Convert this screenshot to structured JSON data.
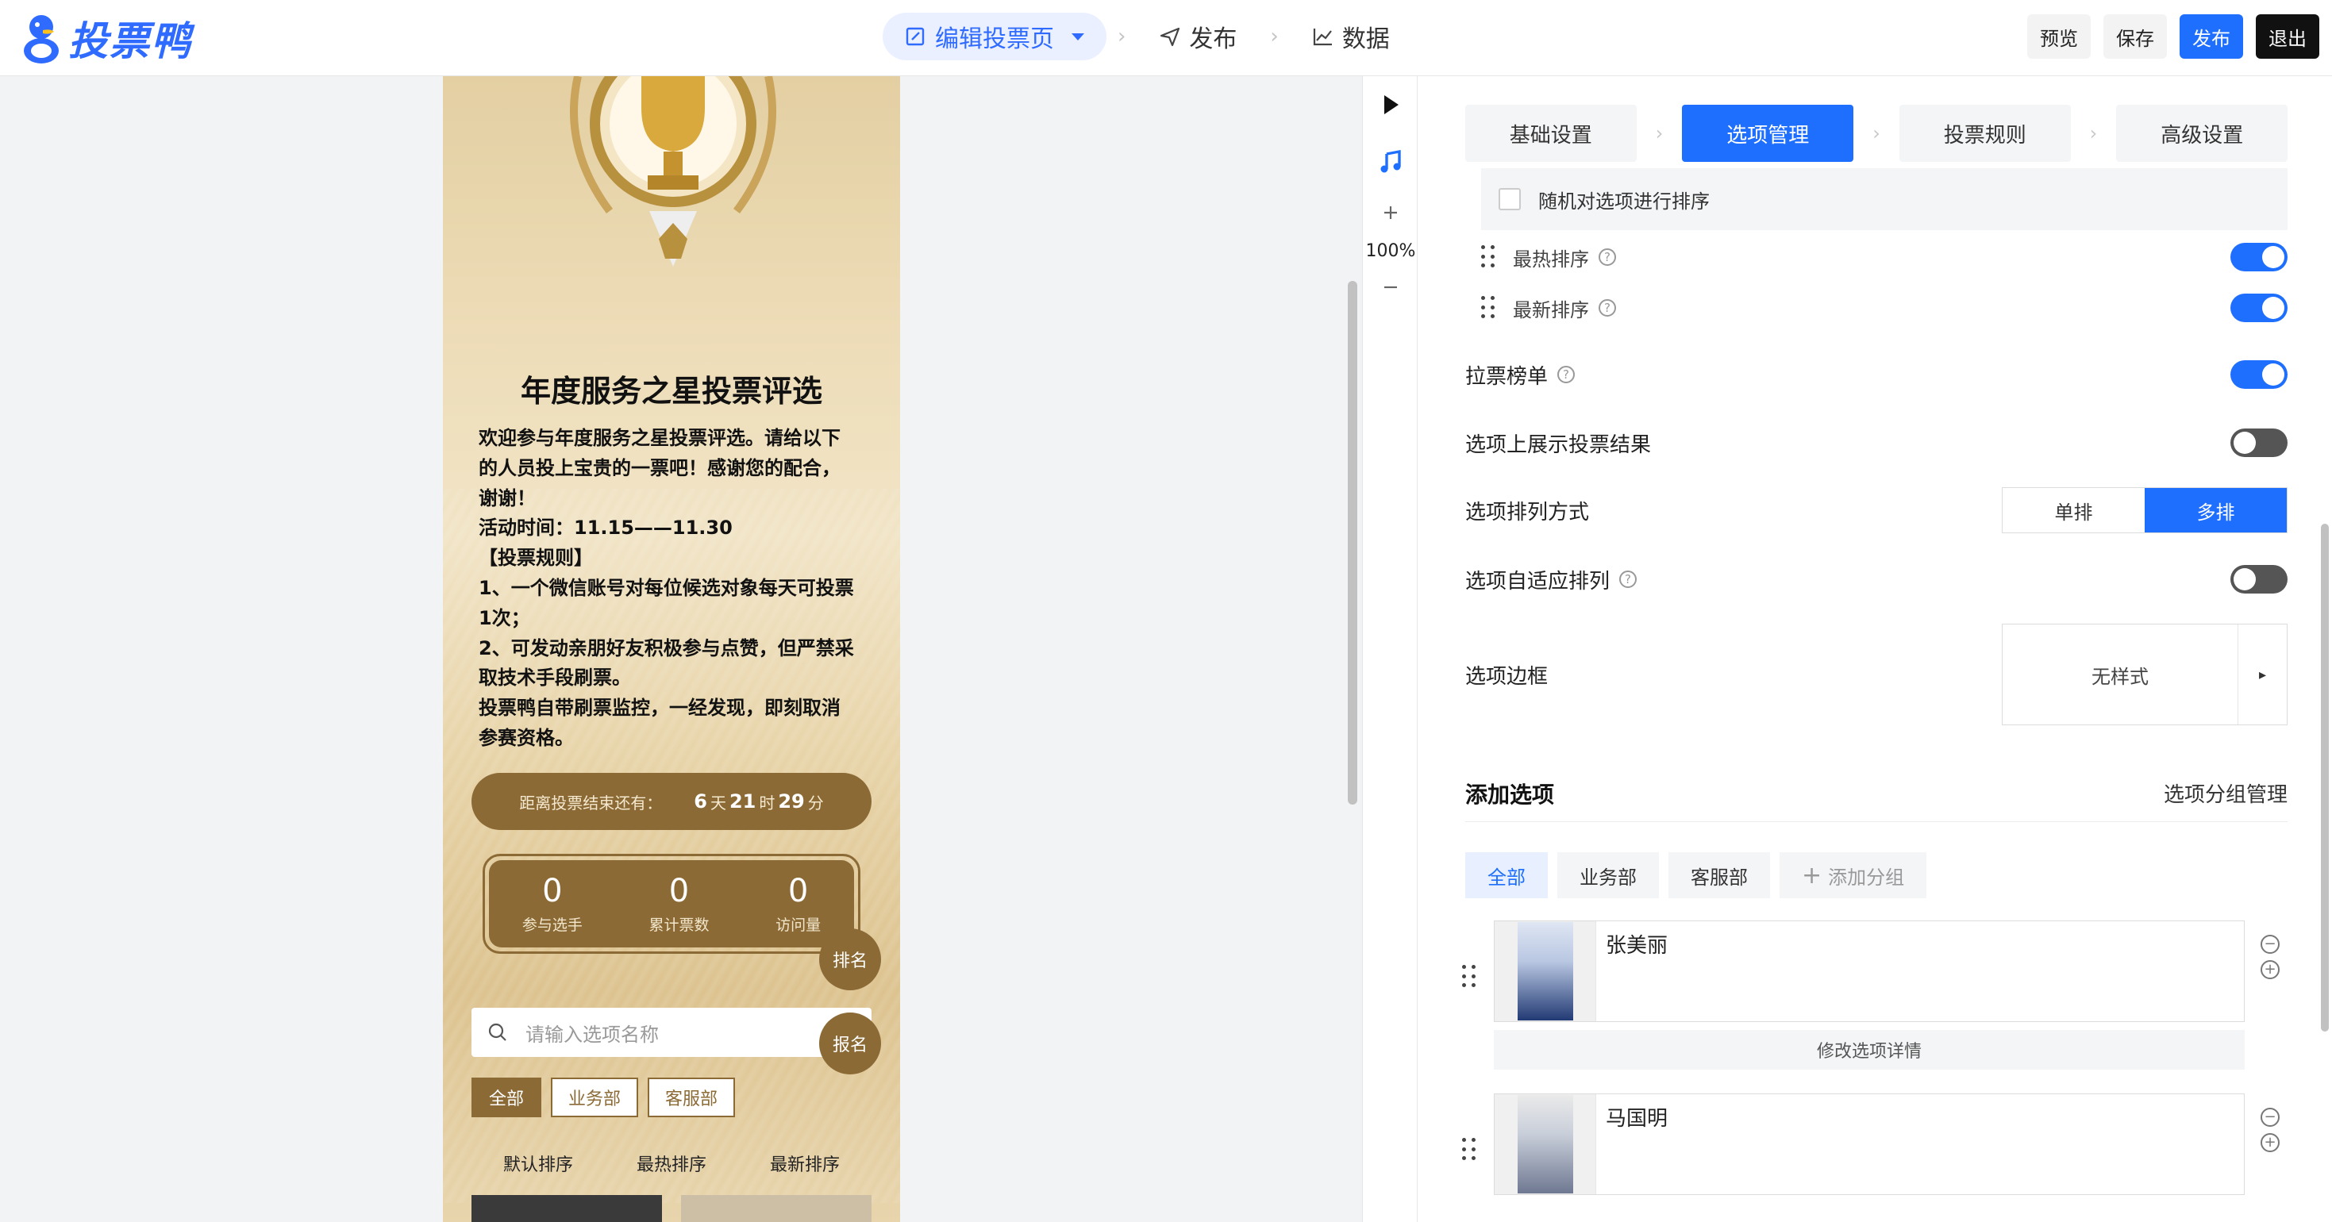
{
  "brand": {
    "name": "投票鸭"
  },
  "steps": [
    {
      "label": "编辑投票页",
      "icon": "edit-icon"
    },
    {
      "label": "发布",
      "icon": "send-icon"
    },
    {
      "label": "数据",
      "icon": "chart-icon"
    }
  ],
  "toolbar": {
    "preview": "预览",
    "save": "保存",
    "publish": "发布",
    "exit": "退出"
  },
  "canvas": {
    "zoom": "100%"
  },
  "phone": {
    "title": "年度服务之星投票评选",
    "description": [
      "欢迎参与年度服务之星投票评选。请给以下",
      "的人员投上宝贵的一票吧！感谢您的配合，",
      "谢谢！",
      "活动时间：11.15——11.30",
      "【投票规则】",
      "1、一个微信账号对每位候选对象每天可投票",
      "1次；",
      "2、可发动亲朋好友积极参与点赞，但严禁采",
      "取技术手段刷票。",
      "投票鸭自带刷票监控，一经发现，即刻取消",
      "参赛资格。"
    ],
    "countdown": {
      "label": "距离投票结束还有：",
      "days": "6",
      "days_unit": "天",
      "hours": "21",
      "hours_unit": "时",
      "minutes": "29",
      "minutes_unit": "分"
    },
    "stats": [
      {
        "value": "0",
        "label": "参与选手"
      },
      {
        "value": "0",
        "label": "累计票数"
      },
      {
        "value": "0",
        "label": "访问量"
      }
    ],
    "rank_btn": "排名",
    "signup_btn": "报名",
    "search_placeholder": "请输入选项名称",
    "tags": [
      "全部",
      "业务部",
      "客服部"
    ],
    "sorts": [
      "默认排序",
      "最热排序",
      "最新排序"
    ]
  },
  "panel": {
    "tabs": [
      "基础设置",
      "选项管理",
      "投票规则",
      "高级设置"
    ],
    "random_sort": "随机对选项进行排序",
    "hot_sort": "最热排序",
    "new_sort": "最新排序",
    "canvass": "拉票榜单",
    "show_result": "选项上展示投票结果",
    "layout_label": "选项排列方式",
    "layout_single": "单排",
    "layout_multi": "多排",
    "adaptive": "选项自适应排列",
    "border_label": "选项边框",
    "border_value": "无样式",
    "add_title": "添加选项",
    "group_manage": "选项分组管理",
    "groups": [
      "全部",
      "业务部",
      "客服部"
    ],
    "add_group": "添加分组",
    "options": [
      {
        "name": "张美丽",
        "edit": "修改选项详情"
      },
      {
        "name": "马国明"
      }
    ]
  }
}
